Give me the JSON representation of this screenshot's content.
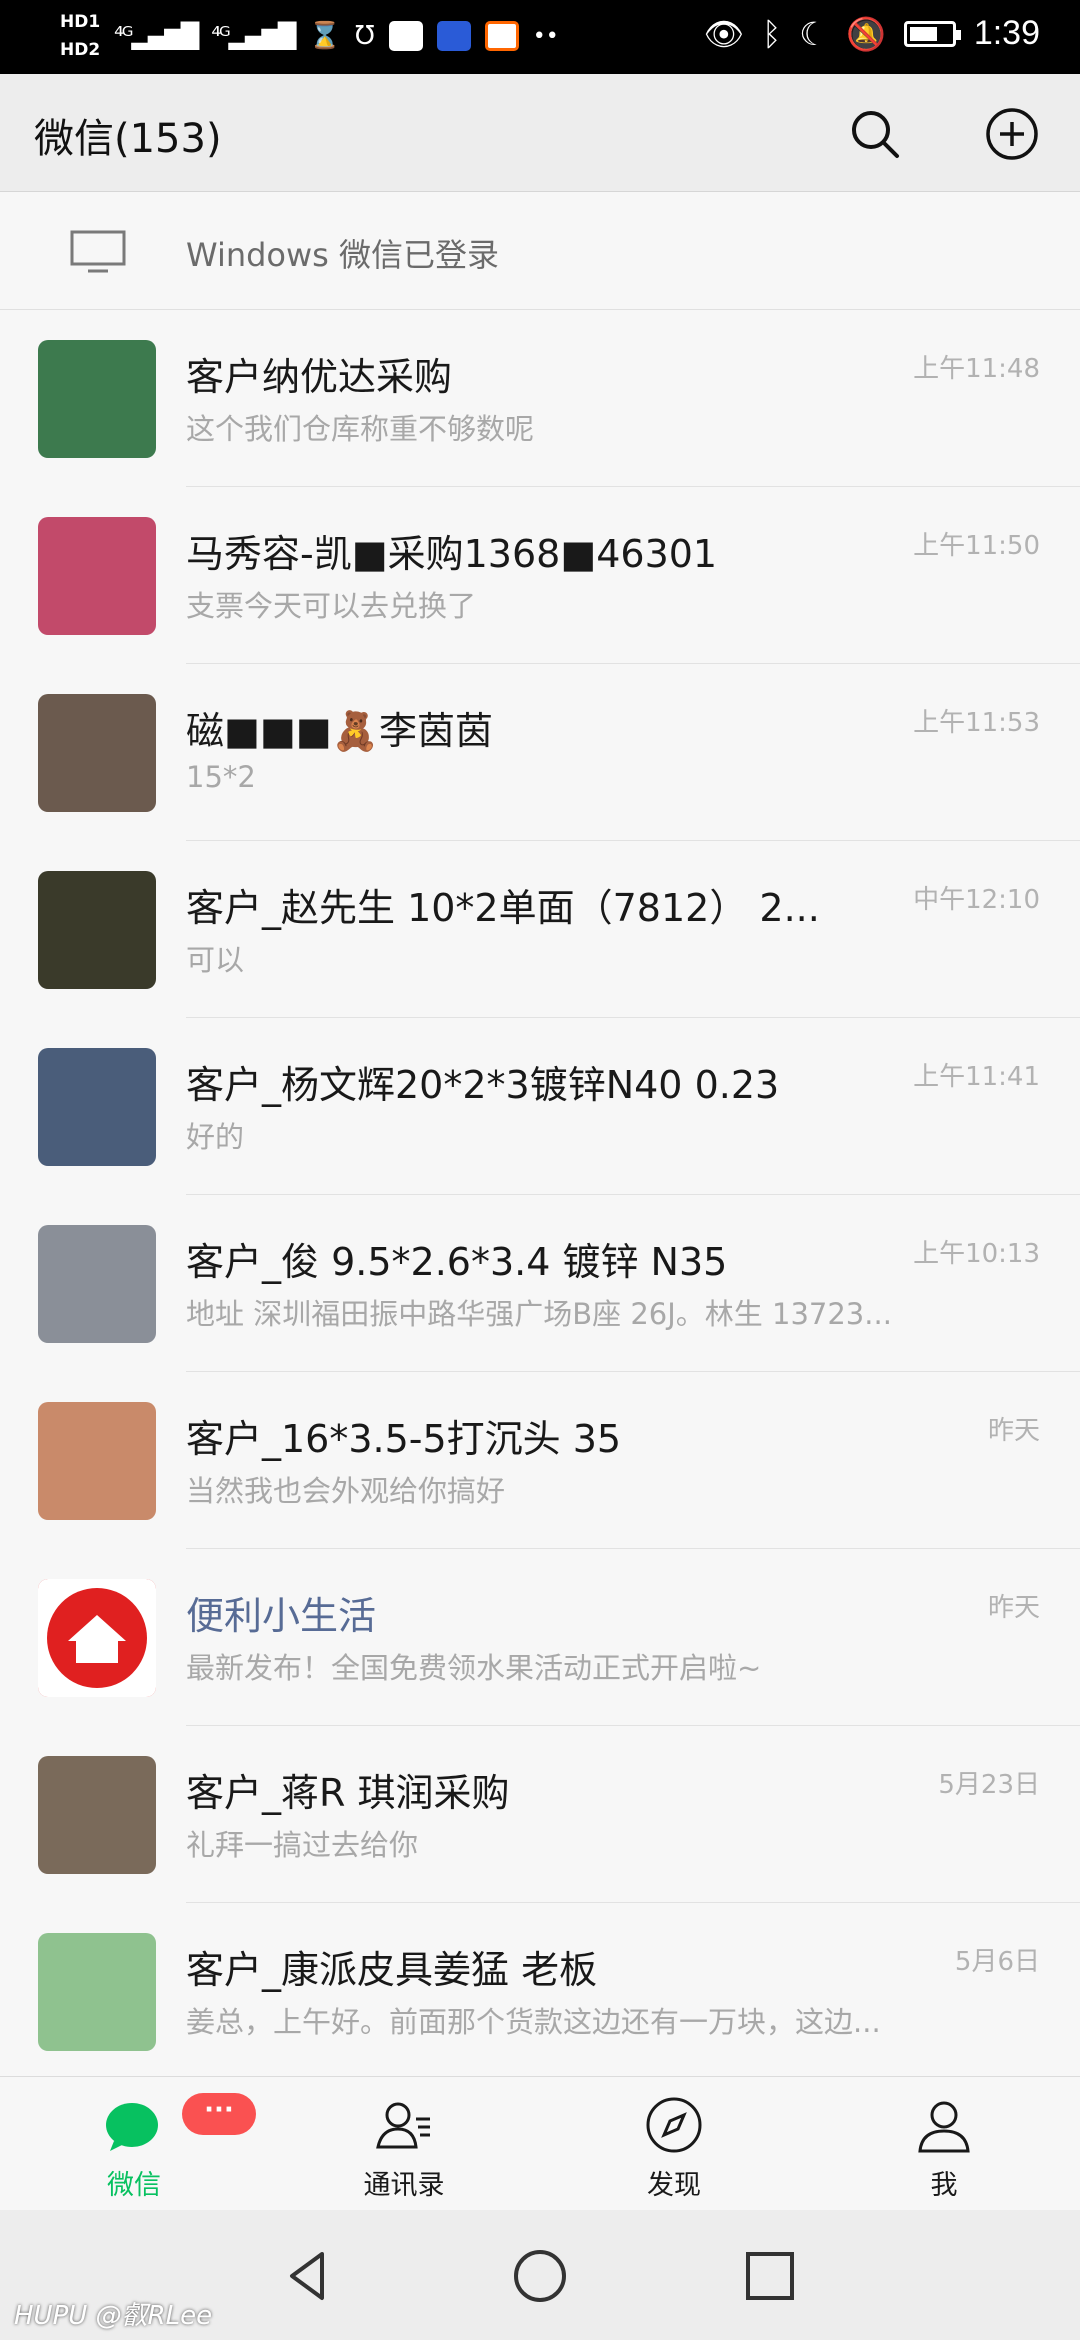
{
  "status_bar": {
    "network_left": [
      "HD1",
      "HD2"
    ],
    "signal": "4G",
    "time": "1:39"
  },
  "header": {
    "title": "微信(153)"
  },
  "windows_login": {
    "text": "Windows 微信已登录"
  },
  "chats": [
    {
      "name": "客户纳优达采购",
      "message": "这个我们仓库称重不够数呢",
      "time": "上午11:48",
      "avatar_color": "#3d7a4e"
    },
    {
      "name": "马秀容-凯■采购1368■46301",
      "message": "支票今天可以去兑换了",
      "time": "上午11:50",
      "avatar_color": "#c24a6a"
    },
    {
      "name": "磁■■■🧸李茵茵",
      "message": "15*2",
      "time": "上午11:53",
      "avatar_color": "#6b5a4e"
    },
    {
      "name": "客户_赵先生   10*2单面（7812） 2...",
      "message": "可以",
      "time": "中午12:10",
      "avatar_color": "#3a3a2a"
    },
    {
      "name": "客户_杨文辉20*2*3镀锌N40   0.23",
      "message": "好的",
      "time": "上午11:41",
      "avatar_color": "#4a5d7a"
    },
    {
      "name": "客户_俊 9.5*2.6*3.4 镀锌  N35",
      "message": "地址 深圳福田振中路华强广场B座 26J。林生 13723...",
      "time": "上午10:13",
      "avatar_color": "#8a8f98"
    },
    {
      "name": "客户_16*3.5-5打沉头  35",
      "message": "当然我也会外观给你搞好",
      "time": "昨天",
      "avatar_color": "#c98a6a"
    },
    {
      "name": "便利小生活",
      "message": "最新发布！全国免费领水果活动正式开启啦~",
      "time": "昨天",
      "avatar_color": "#e02020",
      "official": true
    },
    {
      "name": "客户_蒋R   琪润采购",
      "message": "礼拜一搞过去给你",
      "time": "5月23日",
      "avatar_color": "#7a6a5a"
    },
    {
      "name": "客户_康派皮具姜猛 老板",
      "message": "姜总，上午好。前面那个货款这边还有一万块，这边...",
      "time": "5月6日",
      "avatar_color": "#8fc28f"
    }
  ],
  "bottom_nav": {
    "tabs": [
      {
        "label": "微信",
        "icon": "chat-bubble-icon",
        "active": true,
        "badge": "···"
      },
      {
        "label": "通讯录",
        "icon": "contacts-icon",
        "active": false
      },
      {
        "label": "发现",
        "icon": "compass-icon",
        "active": false
      },
      {
        "label": "我",
        "icon": "person-icon",
        "active": false
      }
    ]
  },
  "watermark": "HUPU @叡RLee",
  "colors": {
    "accent_green": "#07c160",
    "badge_red": "#fa5151",
    "official_blue": "#576b95"
  }
}
